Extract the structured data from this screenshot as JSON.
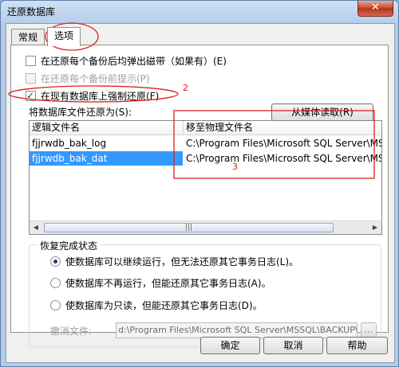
{
  "window": {
    "title": "还原数据库",
    "close_glyph": "✕"
  },
  "tabs": [
    {
      "label": "常规"
    },
    {
      "label": "选项"
    }
  ],
  "options": [
    {
      "label": "在还原每个备份后均弹出磁带（如果有）(E)",
      "checked": false,
      "enabled": true
    },
    {
      "label": "在还原每个备份前提示(P)",
      "checked": false,
      "enabled": false
    },
    {
      "label": "在现有数据库上强制还原(F)",
      "checked": true,
      "enabled": true
    }
  ],
  "restore_files": {
    "label": "将数据库文件还原为(S):",
    "media_button": "从媒体读取(R)",
    "columns": [
      "逻辑文件名",
      "移至物理文件名"
    ],
    "rows": [
      {
        "logical": "fjjrwdb_bak_log",
        "physical": "C:\\Program Files\\Microsoft SQL Server\\MSSQL\\da",
        "selected": false
      },
      {
        "logical": "fjjrwdb_bak_dat",
        "physical": "C:\\Program Files\\Microsoft SQL Server\\MSSQL\\da",
        "selected": true
      }
    ],
    "scroll_grip": "|||"
  },
  "recovery": {
    "legend": "恢复完成状态",
    "choices": [
      {
        "label": "使数据库可以继续运行，但无法还原其它事务日志(L)。",
        "selected": true
      },
      {
        "label": "使数据库不再运行，但能还原其它事务日志(A)。",
        "selected": false
      },
      {
        "label": "使数据库为只读，但能还原其它事务日志(D)。",
        "selected": false
      }
    ],
    "undo_label": "撤消文件:",
    "undo_value": "d:\\Program Files\\Microsoft SQL Server\\MSSQL\\BACKUP\\UNI",
    "browse_label": "..."
  },
  "footer": {
    "ok": "确定",
    "cancel": "取消",
    "help": "帮助"
  },
  "annotations": {
    "n2": "2",
    "n3": "3"
  },
  "colors": {
    "annotation": "#e0201a",
    "selection": "#3399ff"
  }
}
